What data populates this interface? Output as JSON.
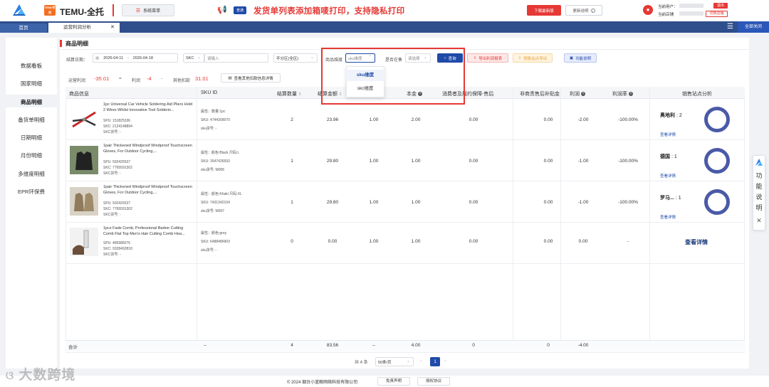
{
  "header": {
    "brand_badge": "TEMU专用",
    "brand_text": "TEMU-全托",
    "menu_label": "系统菜单",
    "notice_tag": "普通",
    "notice_text": "发货单列表添加箱唛打印，支持隐私打印",
    "download_label": "下载最新版",
    "update_label": "更新说明",
    "user_label": "当前用户：",
    "shop_label": "当前店铺",
    "logout_label": "退出",
    "switch_label": "切换店铺"
  },
  "tabs": {
    "home": "首页",
    "active": "运营利润分析",
    "close_all": "全部关闭"
  },
  "sidebar": {
    "items": [
      {
        "label": "数据看板"
      },
      {
        "label": "国家明细"
      },
      {
        "label": "商品明细"
      },
      {
        "label": "备货单明细"
      },
      {
        "label": "日期明细"
      },
      {
        "label": "月份明细"
      },
      {
        "label": "多维度明细"
      },
      {
        "label": "EPR环保费"
      }
    ]
  },
  "panel": {
    "title": "商品明细"
  },
  "filters": {
    "date_label": "结算日期：",
    "date_start": "2026-04-11",
    "date_sep": "-",
    "date_end": "2026-04-18",
    "sku_type": "SKC",
    "sku_placeholder": "请输入",
    "region": "不分区(全区)",
    "dim_label": "商品维度",
    "dim_value": "sku维度",
    "onsale_label": "是否在售",
    "onsale_placeholder": "请选择",
    "query": "查询",
    "export_profit": "导出利润报表",
    "export_site": "销售站点导出",
    "func_desc": "功能说明"
  },
  "dropdown": {
    "options": [
      "sku维度",
      "skc维度"
    ],
    "selected": "sku维度"
  },
  "summary": {
    "op_profit_label": "运营利润",
    "op_profit": "-35.01",
    "eq": "=",
    "profit_label": "利润",
    "profit": "-4",
    "minus": "-",
    "other_label": "其他扣款",
    "other": "31.01",
    "more_btn": "查看其他扣款信息详情"
  },
  "table": {
    "headers": [
      "商品信息",
      "SKU ID",
      "结算数量",
      "结算金额",
      "",
      "",
      "本金",
      "消费者及履约保障-售后",
      "非商责售后补贴金",
      "利润",
      "利润率",
      "销售站点分析"
    ],
    "rows": [
      {
        "title": "1pc Universal Car Vehicle Soldering Aid Pliers Hold 2 Wires Whilst Innovative Tool Solderin...",
        "spu": "SPU:  151825336",
        "skc": "SKC:  2124148894",
        "skc_no": "SKC货号:  -",
        "attr": "属性：数量:1pc",
        "sku": "SKU:  4744309070",
        "sku_no": "sku货号:  -",
        "qty": "2",
        "amount": "23.96",
        "c5": "1.00",
        "c6": "1.00",
        "principal": "2.00",
        "after_sale": "0.00",
        "subsidy": "0.00",
        "profit": "-2.00",
        "rate": "-100.00%",
        "site": "奥地利",
        "site_count": "2",
        "site_link": "查看详情"
      },
      {
        "title": "1pair Thickened Windproof Windproof Touchscreen Gloves, For Outdoor Cycling,...",
        "spu": "SPU:  592425537",
        "skc": "SKC:  7765591302",
        "skc_no": "SKC货号:  -",
        "attr": "属性：颜色:Black 尺码:L",
        "sku": "SKU:  3547426593",
        "sku_no": "sku货号:  M006",
        "qty": "1",
        "amount": "29.80",
        "c5": "1.00",
        "c6": "1.00",
        "principal": "1.00",
        "after_sale": "0.00",
        "subsidy": "0.00",
        "profit": "-1.00",
        "rate": "-100.00%",
        "site": "德国",
        "site_count": "1",
        "site_link": "查看详情"
      },
      {
        "title": "1pair Thickened Windproof Windproof Touchscreen Gloves, For Outdoor Cycling,...",
        "spu": "SPU:  592425537",
        "skc": "SKC:  7765591302",
        "skc_no": "SKC货号:  -",
        "attr": "属性：颜色:Khaki 尺码:XL",
        "sku": "SKU:  7431342104",
        "sku_no": "sku货号:  M007",
        "qty": "1",
        "amount": "29.80",
        "c5": "1.00",
        "c6": "1.00",
        "principal": "1.00",
        "after_sale": "0.00",
        "subsidy": "0.00",
        "profit": "-1.00",
        "rate": "-100.00%",
        "site": "罗马...",
        "site_count": "1",
        "site_link": "查看详情"
      },
      {
        "title": "1pcs Fade Comb, Professional Barber Cutting Comb Flat Top Men's Hair Cutting Comb Hea...",
        "spu": "SPU:  485988276",
        "skc": "SKC:  9328492818",
        "skc_no": "SKC货号:  -",
        "attr": "属性：颜色:grey",
        "sku": "SKU:  6488486903",
        "sku_no": "sku货号:  -",
        "qty": "0",
        "amount": "0.00",
        "c5": "1.00",
        "c6": "1.00",
        "principal": "1.00",
        "after_sale": "0.00",
        "subsidy": "0.00",
        "profit": "0.00",
        "rate": "-",
        "site": "",
        "site_count": "",
        "site_link": "查看详情"
      }
    ],
    "total": {
      "label": "合计",
      "sku": "--",
      "qty": "4",
      "amount": "83.56",
      "c5": "--",
      "principal": "4.00",
      "after_sale": "0",
      "subsidy": "0",
      "profit": "-4.00"
    }
  },
  "pagination": {
    "total": "共 4 条",
    "page_size": "50条/页",
    "page": "1"
  },
  "footer": {
    "copyright": "© 2024 烟台小蓝鲸网络科技有限公司",
    "disclaimer": "免责声明",
    "license": "授权协议"
  },
  "watermark": "大数跨境",
  "float_help": {
    "text": "功能说明",
    "close": "✕"
  },
  "colors": {
    "brand_red": "#e53935",
    "primary_blue": "#1e4aa8",
    "tab_bar": "#2f4f8c"
  }
}
